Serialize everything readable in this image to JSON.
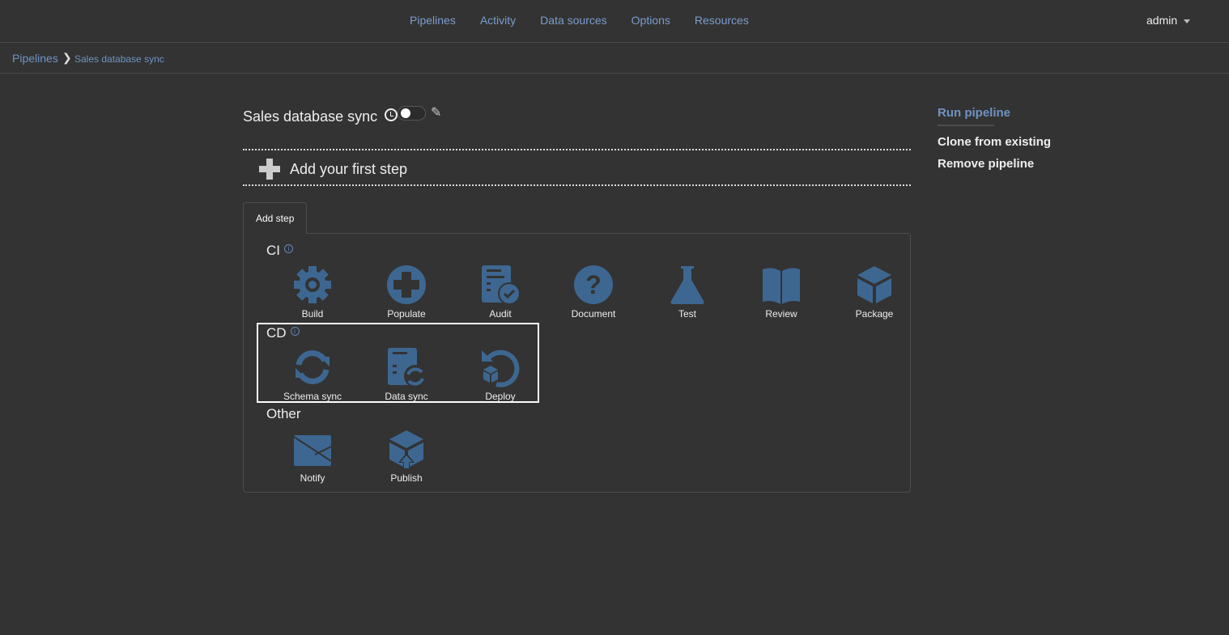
{
  "nav": {
    "links": [
      "Pipelines",
      "Activity",
      "Data sources",
      "Options",
      "Resources"
    ],
    "user": "admin"
  },
  "breadcrumb": {
    "root": "Pipelines",
    "separator": ">",
    "current": "Sales database sync"
  },
  "pipeline": {
    "title": "Sales database sync",
    "schedule_enabled": false,
    "add_first_step": "Add your first step"
  },
  "tab": "Add step",
  "sections": {
    "ci": {
      "title": "CI",
      "info": "i",
      "items": [
        "Build",
        "Populate",
        "Audit",
        "Document",
        "Test",
        "Review",
        "Package"
      ]
    },
    "cd": {
      "title": "CD",
      "info": "i",
      "items": [
        "Schema sync",
        "Data sync",
        "Deploy"
      ]
    },
    "other": {
      "title": "Other",
      "items": [
        "Notify",
        "Publish"
      ]
    }
  },
  "sidebar": {
    "run": "Run pipeline",
    "clone": "Clone from existing",
    "remove": "Remove pipeline"
  },
  "colors": {
    "background": "#333333",
    "link": "#6f93c4",
    "icon": "#3d6791"
  }
}
